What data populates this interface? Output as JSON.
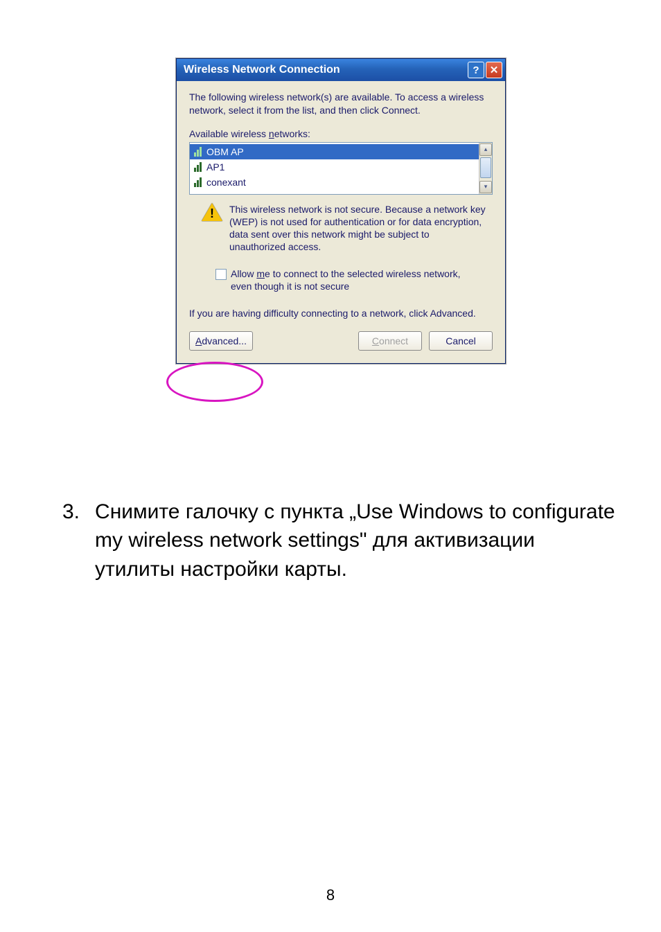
{
  "dialog": {
    "title": "Wireless Network Connection",
    "intro": "The following wireless network(s) are available. To access a wireless network, select it from the list, and then click Connect.",
    "available_label_pre": "Available wireless ",
    "available_label_u": "n",
    "available_label_post": "etworks:",
    "networks": [
      {
        "name": "OBM AP"
      },
      {
        "name": "AP1"
      },
      {
        "name": "conexant"
      }
    ],
    "warning": "This wireless network is not secure. Because a network key (WEP) is not used for authentication or for data encryption, data sent over this network might be subject to unauthorized access.",
    "allow_pre": "Allow ",
    "allow_u": "m",
    "allow_post": "e to connect to the selected wireless network, even though it is not secure",
    "difficulty": "If you are having difficulty connecting to a network, click Advanced.",
    "advanced_u": "A",
    "advanced_post": "dvanced...",
    "connect_u": "C",
    "connect_post": "onnect",
    "cancel": "Cancel"
  },
  "doc": {
    "num": "3.",
    "text": "Снимите галочку с пункта „Use Windows to configurate my wireless network settings\" для активизации утилиты настройки карты."
  },
  "page_number": "8"
}
